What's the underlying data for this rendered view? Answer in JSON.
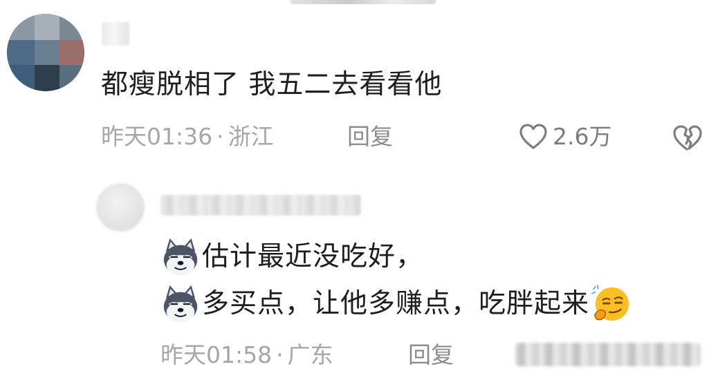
{
  "comment": {
    "text": "都瘦脱相了 我五二去看看他",
    "time": "昨天01:36",
    "separator": "·",
    "location": "浙江",
    "reply_label": "回复",
    "likes": "2.6万"
  },
  "reply": {
    "line1": "估计最近没吃好，",
    "line2": "多买点，让他多赚点，吃胖起来",
    "time": "昨天01:58",
    "separator": "·",
    "location": "广东",
    "reply_label": "回复"
  },
  "icons": {
    "like": "heart-outline-icon",
    "dislike": "broken-heart-icon",
    "emoji_husky": "husky-dog-emoji",
    "emoji_smirk": "smirk-thinking-emoji"
  },
  "colors": {
    "text": "#1e1e1e",
    "meta": "#a6a6a6",
    "reply": "#8c8c8c",
    "like": "#7d7d7d"
  }
}
